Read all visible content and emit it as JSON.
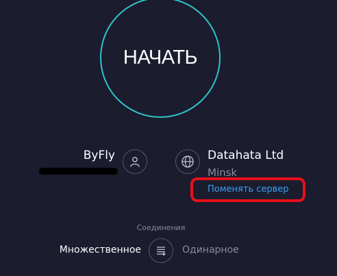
{
  "start_button": {
    "label": "НАЧАТЬ"
  },
  "provider": {
    "isp_name": "ByFly"
  },
  "server": {
    "name": "Datahata Ltd",
    "city": "Minsk",
    "change_label": "Поменять сервер"
  },
  "connections": {
    "heading": "Соединения",
    "multi_label": "Множественное",
    "single_label": "Одинарное",
    "selected": "Множественное"
  },
  "colors": {
    "background": "#1b1c2e",
    "accent_ring": "#2ec4c7",
    "link": "#3aa0f0",
    "annotation": "#e8101a"
  },
  "icons": [
    "user-icon",
    "globe-icon",
    "connections-mode-icon"
  ]
}
